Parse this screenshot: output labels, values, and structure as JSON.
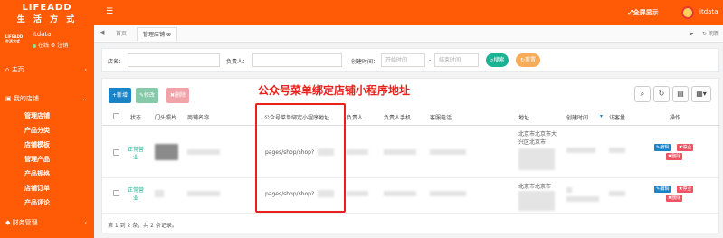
{
  "sidebar": {
    "logo_line1": "LIFEADD",
    "logo_line2": "生 活 方 式",
    "user_logo_line1": "LIFEADD",
    "user_logo_line2": "生活方式",
    "username": "itdata",
    "status": "在线",
    "role": "注销",
    "nav": [
      {
        "label": "主页",
        "icon": "home-icon"
      },
      {
        "label": "我的店铺",
        "icon": "shop-icon"
      }
    ],
    "sub_items": [
      "管理店铺",
      "产品分类",
      "店铺模板",
      "管理产品",
      "产品规格",
      "店铺订单",
      "产品评论"
    ],
    "bottom_item": "财务管理"
  },
  "topbar": {
    "fullscreen": "全屏显示",
    "username": "itdata"
  },
  "tabs": {
    "items": [
      "首页",
      "管理店铺"
    ]
  },
  "search": {
    "shop_name_label": "店名：",
    "owner_label": "负责人：",
    "created_label": "创建时间：",
    "start_placeholder": "开始时间",
    "range_sep": "-",
    "end_placeholder": "结束时间",
    "search_button": "搜索",
    "reset_button": "重置"
  },
  "toolbar": {
    "add": "+新增",
    "edit": "修改",
    "delete": "删除",
    "annotation": "公众号菜单绑定店铺小程序地址"
  },
  "table": {
    "columns": [
      "状态",
      "门头照片",
      "商铺名称",
      "公众号菜单绑定小程序地址",
      "负责人",
      "负责人手机",
      "客服电话",
      "地址",
      "创建时间",
      "访客量",
      "操作"
    ],
    "rows": [
      {
        "status": "正常营业",
        "path": "pages/shop/shop?",
        "address": "北京市北京市大兴区北京市",
        "edit": "编辑",
        "stop": "停业",
        "delete": "删除"
      },
      {
        "status": "正常营业",
        "path": "pages/shop/shop?",
        "address": "北京市北京市",
        "edit": "编辑",
        "stop": "停业",
        "delete": "删除"
      }
    ],
    "footer": "第 1 到 2 条，共 2 条记录。"
  },
  "colors": {
    "brand": "#ff5a05",
    "primary": "#1c84c6",
    "success": "#1ab394",
    "warning": "#f8ac59",
    "danger": "#ed5565",
    "annotation": "#e8211d"
  }
}
